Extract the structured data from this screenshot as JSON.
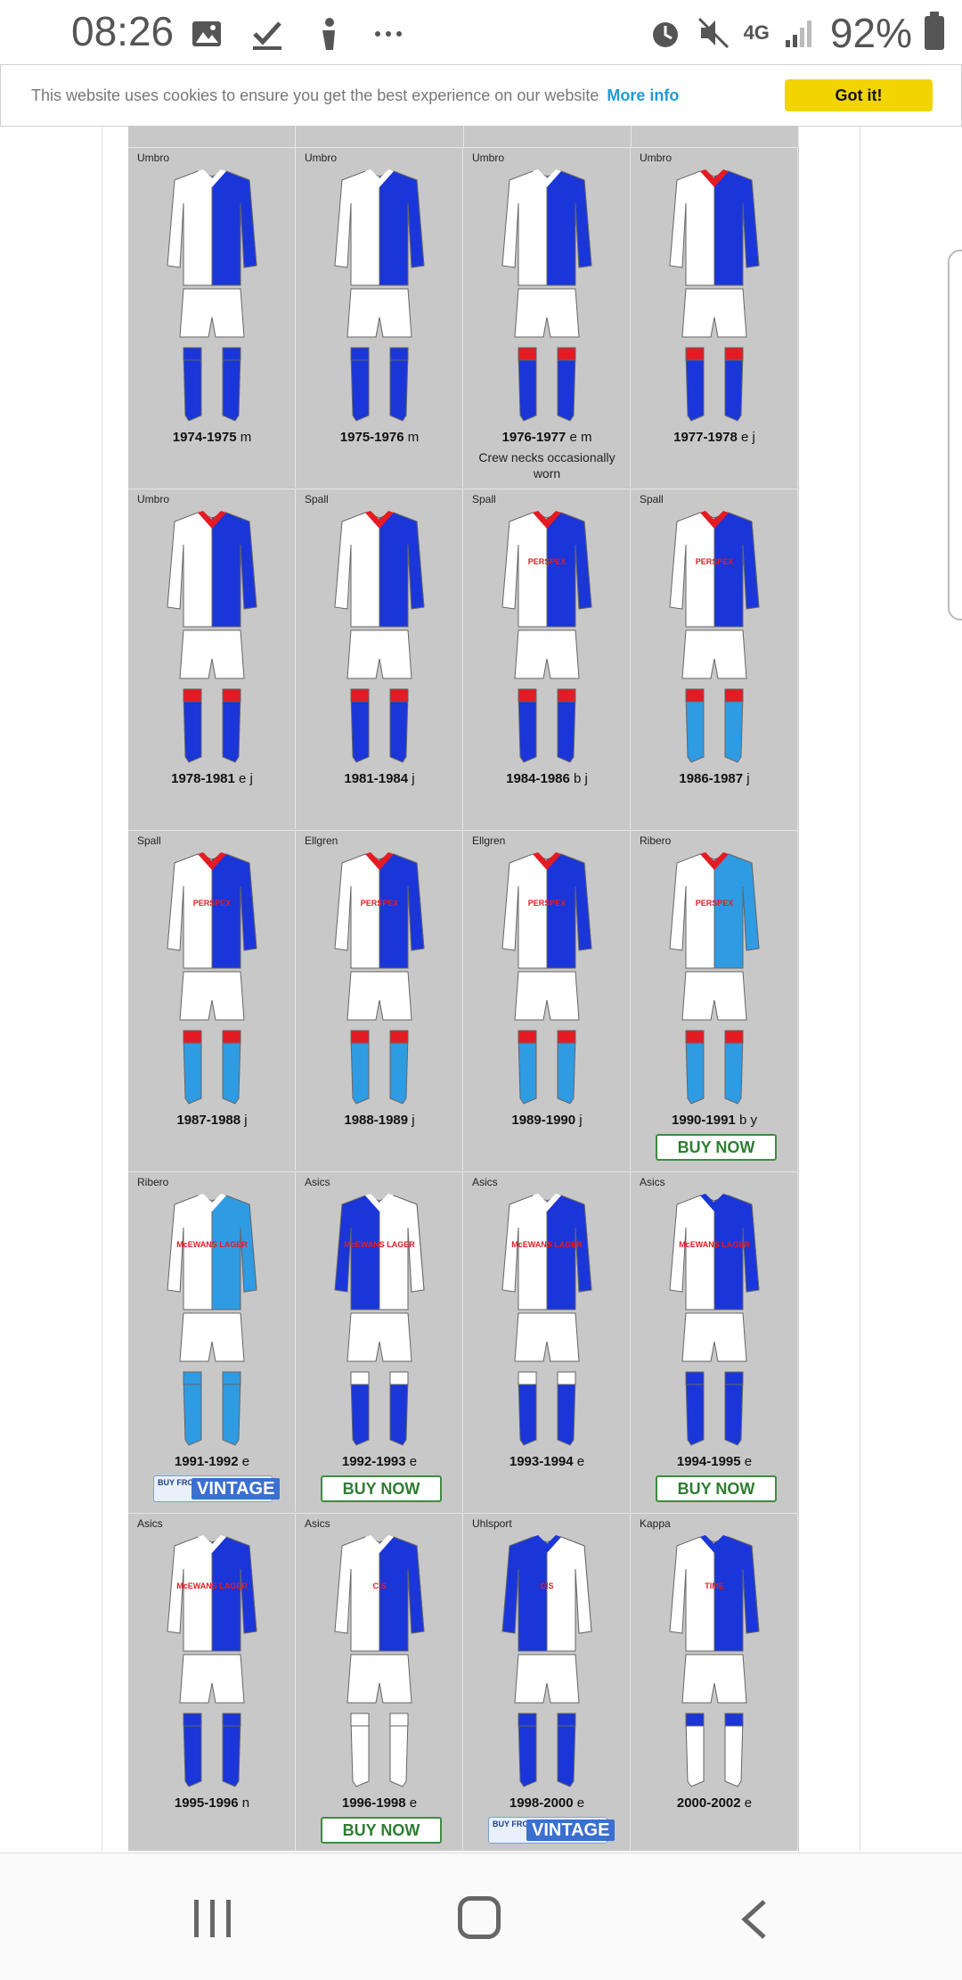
{
  "status": {
    "time": "08:26",
    "network": "4G",
    "battery": "92%",
    "left_icons": [
      "image-icon",
      "check-icon",
      "person-icon",
      "more-icon"
    ],
    "right_icons": [
      "alarm-icon",
      "mute-icon",
      "network-icon",
      "signal-icon",
      "battery-icon"
    ]
  },
  "cookie": {
    "message": "This website uses cookies to ensure you get the best experience on our website",
    "more_info": "More info",
    "button": "Got it!"
  },
  "colors": {
    "blue": "#1a35d8",
    "white": "#ffffff",
    "red": "#e41b23",
    "light_blue": "#2f9be3",
    "grid_bg": "#c8c8c8",
    "cookie_button": "#f2d500"
  },
  "kits": [
    {
      "brand": "Umbro",
      "years": "1974-1975",
      "codes": "m",
      "right": "blue",
      "collar": "white",
      "sock_top": "blue",
      "sock_body": "blue"
    },
    {
      "brand": "Umbro",
      "years": "1975-1976",
      "codes": "m",
      "right": "blue",
      "collar": "white",
      "sock_top": "blue",
      "sock_body": "blue"
    },
    {
      "brand": "Umbro",
      "years": "1976-1977",
      "codes": "e m",
      "note": "Crew necks occasionally worn",
      "right": "blue",
      "collar": "white",
      "sock_top": "red",
      "sock_body": "blue"
    },
    {
      "brand": "Umbro",
      "years": "1977-1978",
      "codes": "e j",
      "right": "blue",
      "collar": "red",
      "sock_top": "red",
      "sock_body": "blue"
    },
    {
      "brand": "Umbro",
      "years": "1978-1981",
      "codes": "e j",
      "right": "blue",
      "collar": "red",
      "sock_top": "red",
      "sock_body": "blue"
    },
    {
      "brand": "Spall",
      "years": "1981-1984",
      "codes": "j",
      "right": "blue",
      "collar": "red",
      "sock_top": "red",
      "sock_body": "blue"
    },
    {
      "brand": "Spall",
      "years": "1984-1986",
      "codes": "b j",
      "right": "blue",
      "collar": "red",
      "sock_top": "red",
      "sock_body": "blue",
      "sponsor": "PERSPEX"
    },
    {
      "brand": "Spall",
      "years": "1986-1987",
      "codes": "j",
      "right": "blue",
      "collar": "red",
      "sock_top": "red",
      "sock_body": "light_blue",
      "sponsor": "PERSPEX"
    },
    {
      "brand": "Spall",
      "years": "1987-1988",
      "codes": "j",
      "right": "blue",
      "collar": "red",
      "sock_top": "red",
      "sock_body": "light_blue",
      "sponsor": "PERSPEX"
    },
    {
      "brand": "Ellgren",
      "years": "1988-1989",
      "codes": "j",
      "right": "blue",
      "collar": "red",
      "sock_top": "red",
      "sock_body": "light_blue",
      "sponsor": "PERSPEX"
    },
    {
      "brand": "Ellgren",
      "years": "1989-1990",
      "codes": "j",
      "right": "blue",
      "collar": "red",
      "sock_top": "red",
      "sock_body": "light_blue",
      "sponsor": "PERSPEX"
    },
    {
      "brand": "Ribero",
      "years": "1990-1991",
      "codes": "b y",
      "right": "light_blue",
      "collar": "red",
      "sock_top": "red",
      "sock_body": "light_blue",
      "sponsor": "PERSPEX",
      "badge": "buy",
      "badge_text": "BUY NOW"
    },
    {
      "brand": "Ribero",
      "years": "1991-1992",
      "codes": "e",
      "right": "light_blue",
      "collar": "white",
      "sock_top": "light_blue",
      "sock_body": "light_blue",
      "sponsor": "McEWANS LAGER",
      "badge": "vintage",
      "badge_small": "BUY FROM",
      "badge_big": "VINTAGE"
    },
    {
      "brand": "Asics",
      "years": "1992-1993",
      "codes": "e",
      "right": "white",
      "left": "blue",
      "collar": "white",
      "sock_top": "white",
      "sock_body": "blue",
      "sponsor": "McEWANS LAGER",
      "badge": "buy",
      "badge_text": "BUY NOW"
    },
    {
      "brand": "Asics",
      "years": "1993-1994",
      "codes": "e",
      "right": "blue",
      "collar": "white",
      "sock_top": "white",
      "sock_body": "blue",
      "sponsor": "McEWANS LAGER"
    },
    {
      "brand": "Asics",
      "years": "1994-1995",
      "codes": "e",
      "right": "blue",
      "collar": "blue",
      "sock_top": "blue",
      "sock_body": "blue",
      "sponsor": "McEWANS LAGER",
      "badge": "buy",
      "badge_text": "BUY NOW"
    },
    {
      "brand": "Asics",
      "years": "1995-1996",
      "codes": "n",
      "right": "blue",
      "collar": "white",
      "sock_top": "blue",
      "sock_body": "blue",
      "sponsor": "McEWANS LAGER"
    },
    {
      "brand": "Asics",
      "years": "1996-1998",
      "codes": "e",
      "right": "blue",
      "collar": "white",
      "sock_top": "white",
      "sock_body": "white",
      "sponsor": "CIS",
      "badge": "buy",
      "badge_text": "BUY NOW"
    },
    {
      "brand": "Uhlsport",
      "years": "1998-2000",
      "codes": "e",
      "right": "white",
      "left": "blue",
      "collar": "blue",
      "sock_top": "blue",
      "sock_body": "blue",
      "sponsor": "CIS",
      "badge": "vintage",
      "badge_small": "BUY FROM",
      "badge_big": "VINTAGE"
    },
    {
      "brand": "Kappa",
      "years": "2000-2002",
      "codes": "e",
      "right": "blue",
      "collar": "blue",
      "sock_top": "blue",
      "sock_body": "white",
      "sponsor": "TIME"
    }
  ]
}
